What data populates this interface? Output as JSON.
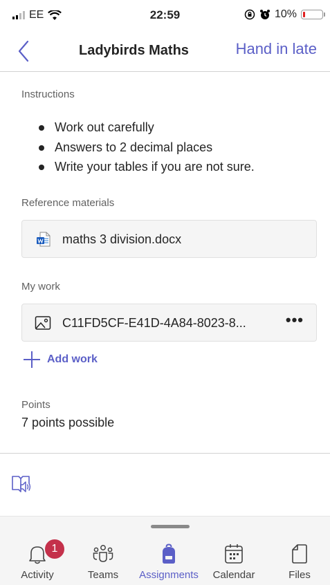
{
  "status_bar": {
    "carrier": "EE",
    "time": "22:59",
    "battery": "10%",
    "battery_level": 0.1
  },
  "header": {
    "title": "Ladybirds Maths",
    "action": "Hand in late"
  },
  "instructions": {
    "label": "Instructions",
    "items": [
      "Work out carefully",
      "Answers to 2 decimal places",
      "Write your tables if you are not sure."
    ]
  },
  "reference": {
    "label": "Reference materials",
    "file": "maths 3 division.docx"
  },
  "my_work": {
    "label": "My work",
    "file": "C11FD5CF-E41D-4A84-8023-8...",
    "add_label": "Add work"
  },
  "points": {
    "label": "Points",
    "value": "7 points possible"
  },
  "tabs": [
    {
      "label": "Activity",
      "badge": "1"
    },
    {
      "label": "Teams"
    },
    {
      "label": "Assignments"
    },
    {
      "label": "Calendar"
    },
    {
      "label": "Files"
    }
  ],
  "colors": {
    "accent": "#5b5fc7",
    "badge": "#c4314b",
    "battery_low": "#e02020"
  }
}
